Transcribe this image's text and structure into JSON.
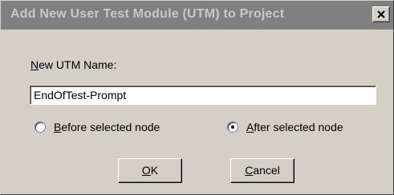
{
  "dialog": {
    "title": "Add New User Test Module (UTM) to Project",
    "close_icon": "close-icon"
  },
  "form": {
    "name_label_accel": "N",
    "name_label_rest": "ew UTM Name:",
    "name_value": "EndOfTest-Prompt"
  },
  "position": {
    "before_accel": "B",
    "before_rest": "efore selected node",
    "before_selected": false,
    "after_accel": "A",
    "after_rest": "fter selected node",
    "after_selected": true
  },
  "buttons": {
    "ok_accel": "O",
    "ok_rest": "K",
    "cancel_accel": "C",
    "cancel_rest": "ancel"
  }
}
